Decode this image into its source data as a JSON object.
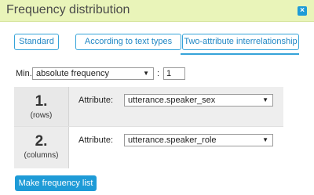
{
  "window": {
    "title": "Frequency distribution",
    "close_symbol": "×"
  },
  "tabs": [
    "Standard",
    "According to text types",
    "Two-attribute interrelationship"
  ],
  "active_tab": 2,
  "min": {
    "label": "Min.",
    "type_value": "absolute frequency",
    "separator": ":",
    "threshold": "1"
  },
  "rows": [
    {
      "number": "1.",
      "caption": "(rows)",
      "attr_label": "Attribute:",
      "attr_value": "utterance.speaker_sex"
    },
    {
      "number": "2.",
      "caption": "(columns)",
      "attr_label": "Attribute:",
      "attr_value": "utterance.speaker_role"
    }
  ],
  "submit_label": "Make frequency list",
  "icons": {
    "close": "close-icon",
    "dropdown": "chevron-down-icon"
  },
  "colors": {
    "titlebar_bg": "#e9f4b9",
    "accent": "#1e9bd7"
  }
}
